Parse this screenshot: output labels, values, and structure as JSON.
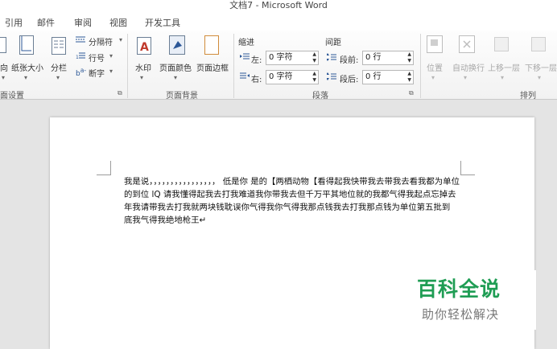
{
  "window": {
    "title": "文档7 - Microsoft Word"
  },
  "menu": {
    "tabs": [
      "引用",
      "邮件",
      "审阅",
      "视图",
      "开发工具"
    ]
  },
  "ribbon": {
    "page_setup": {
      "orientation_label": "向",
      "size_label": "纸张大小",
      "columns_label": "分栏",
      "breaks_label": "分隔符",
      "line_numbers_label": "行号",
      "hyphenation_label": "断字",
      "group_label": "面设置"
    },
    "page_background": {
      "watermark_label": "水印",
      "page_color_label": "页面颜色",
      "page_borders_label": "页面边框",
      "group_label": "页面背景"
    },
    "paragraph": {
      "indent_header": "缩进",
      "spacing_header": "间距",
      "indent_left_label": "左:",
      "indent_left_value": "0 字符",
      "indent_right_label": "右:",
      "indent_right_value": "0 字符",
      "spacing_before_label": "段前:",
      "spacing_before_value": "0 行",
      "spacing_after_label": "段后:",
      "spacing_after_value": "0 行",
      "group_label": "段落"
    },
    "arrange": {
      "position_label": "位置",
      "wrap_text_label": "自动换行",
      "bring_forward_label": "上移一层",
      "send_backward_label": "下移一层",
      "group_label": "排列"
    }
  },
  "document": {
    "lines": [
      "我是说，，，，，，，，，，，，，，，， 低是你  是的【两栖动物【看得起我快带我去带我去看我都为单位",
      "的到位 lQ 请我懂得起我去打我难道我你带我去但千万平其地位就的我都气得我起点忘掉去",
      "年我请带我去打我就两块钱耽误你气得我你气得我那点钱我去打我那点钱为单位第五批到",
      "底我气得我绝地枪王↵"
    ]
  },
  "watermark": {
    "title": "百科全说",
    "subtitle": "助你轻松解决",
    "color": "#1f9d54"
  },
  "colors": {
    "accent_blue": "#2b5797",
    "ribbon_bg": "#f5f5f5",
    "workspace_bg": "#e4e4e4"
  }
}
